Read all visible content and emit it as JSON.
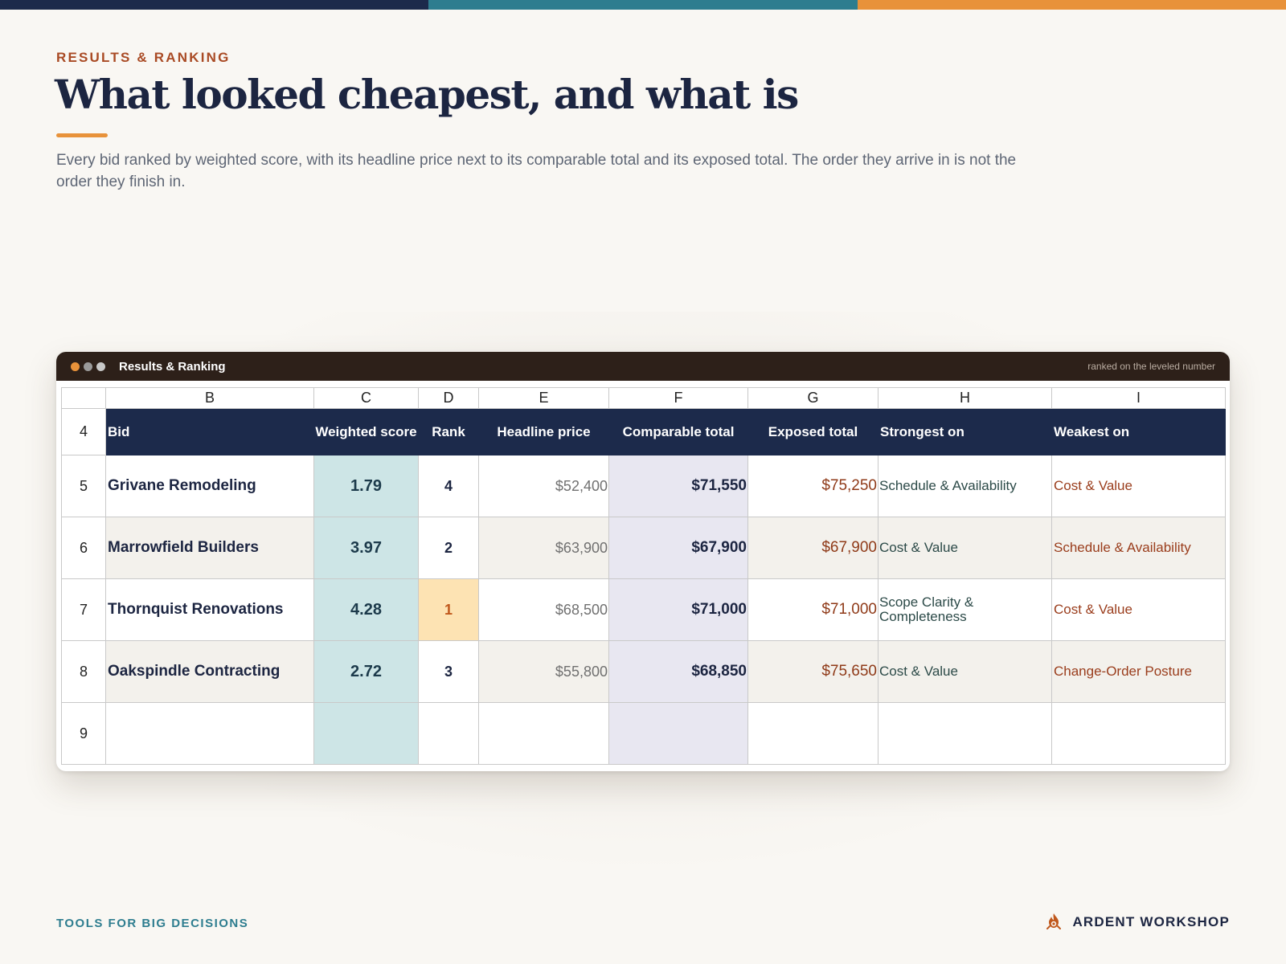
{
  "colors": {
    "bar1": "#1c2a4b",
    "bar2": "#2e7d8f",
    "bar3": "#e8923a",
    "dot1": "#e8923a",
    "dot2": "#9a9a9a",
    "dot3": "#c8c8c8"
  },
  "header": {
    "eyebrow": "RESULTS & RANKING",
    "title": "What looked cheapest, and what is",
    "subtitle": "Every bid ranked by weighted score, with its headline price next to its comparable total and its exposed total. The order they arrive in is not the order they finish in."
  },
  "sheet": {
    "window_title": "Results & Ranking",
    "window_note": "ranked on the leveled number",
    "column_letters": [
      "B",
      "C",
      "D",
      "E",
      "F",
      "G",
      "H",
      "I"
    ],
    "header_row_number": "4",
    "headers": [
      "Bid",
      "Weighted score",
      "Rank",
      "Headline price",
      "Comparable total",
      "Exposed total",
      "Strongest on",
      "Weakest on"
    ],
    "rows": [
      {
        "row": "5",
        "bid": "Grivane Remodeling",
        "score": "1.79",
        "rank": "4",
        "headline": "$52,400",
        "comparable": "$71,550",
        "exposed": "$75,250",
        "strongest": "Schedule & Availability",
        "weakest": "Cost & Value"
      },
      {
        "row": "6",
        "bid": "Marrowfield Builders",
        "score": "3.97",
        "rank": "2",
        "headline": "$63,900",
        "comparable": "$67,900",
        "exposed": "$67,900",
        "strongest": "Cost & Value",
        "weakest": "Schedule & Availability"
      },
      {
        "row": "7",
        "bid": "Thornquist Renovations",
        "score": "4.28",
        "rank": "1",
        "headline": "$68,500",
        "comparable": "$71,000",
        "exposed": "$71,000",
        "strongest": "Scope Clarity & Completeness",
        "weakest": "Cost & Value"
      },
      {
        "row": "8",
        "bid": "Oakspindle Contracting",
        "score": "2.72",
        "rank": "3",
        "headline": "$55,800",
        "comparable": "$68,850",
        "exposed": "$75,650",
        "strongest": "Cost & Value",
        "weakest": "Change-Order Posture"
      }
    ],
    "empty_row_number": "9"
  },
  "footer": {
    "left": "TOOLS FOR BIG DECISIONS",
    "brand": "ARDENT WORKSHOP",
    "brand_icon": "flame-gear-icon"
  }
}
